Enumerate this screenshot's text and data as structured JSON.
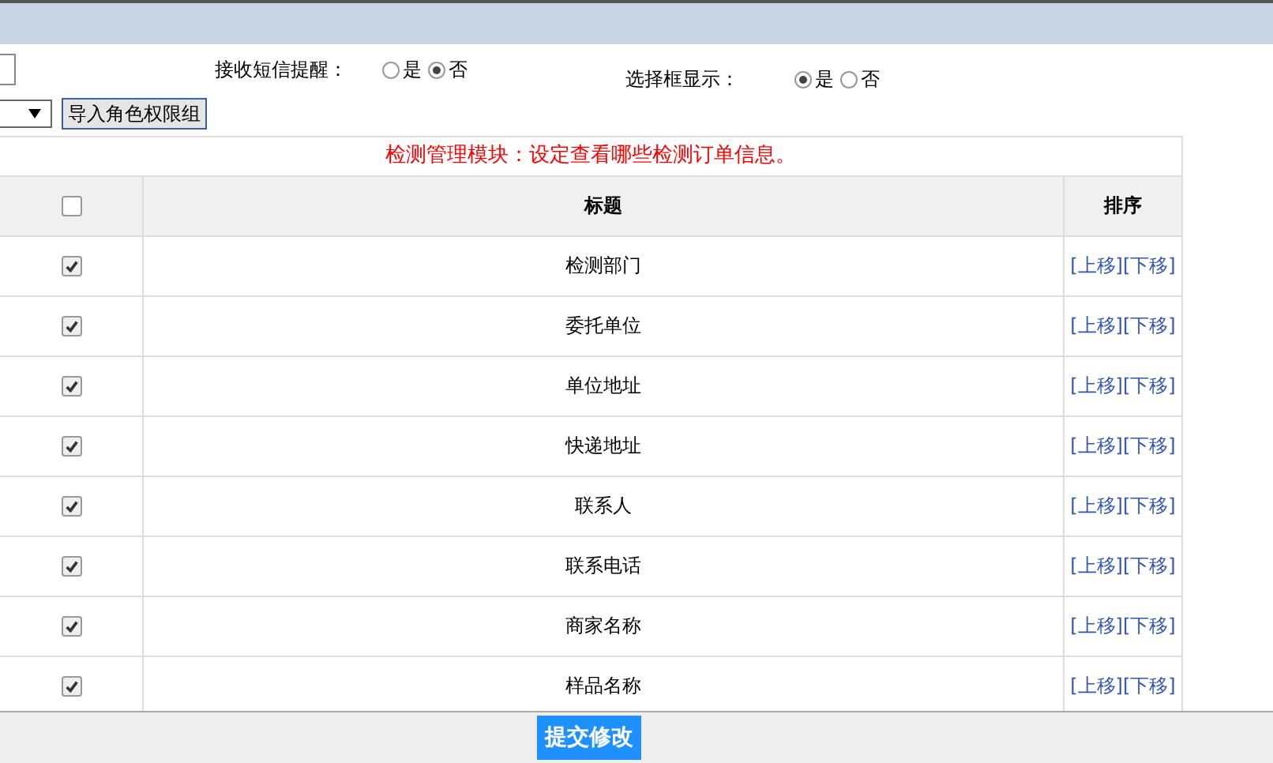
{
  "settings": [
    {
      "label": "接收短信提醒：",
      "options": [
        {
          "label": "是",
          "selected": false
        },
        {
          "label": "否",
          "selected": true
        }
      ]
    },
    {
      "label": "选择框显示：",
      "options": [
        {
          "label": "是",
          "selected": true
        },
        {
          "label": "否",
          "selected": false
        }
      ]
    }
  ],
  "import_button": "导入角色权限组",
  "table": {
    "caption": "检测管理模块：设定查看哪些检测订单信息。",
    "select_all": {
      "checked": false
    },
    "columns": [
      "标题",
      "排序"
    ],
    "rows": [
      {
        "checked": true,
        "title": "检测部门",
        "up": "[上移]",
        "down": "[下移]"
      },
      {
        "checked": true,
        "title": "委托单位",
        "up": "[上移]",
        "down": "[下移]"
      },
      {
        "checked": true,
        "title": "单位地址",
        "up": "[上移]",
        "down": "[下移]"
      },
      {
        "checked": true,
        "title": "快递地址",
        "up": "[上移]",
        "down": "[下移]"
      },
      {
        "checked": true,
        "title": "联系人",
        "up": "[上移]",
        "down": "[下移]"
      },
      {
        "checked": true,
        "title": "联系电话",
        "up": "[上移]",
        "down": "[下移]"
      },
      {
        "checked": true,
        "title": "商家名称",
        "up": "[上移]",
        "down": "[下移]"
      },
      {
        "checked": true,
        "title": "样品名称",
        "up": "[上移]",
        "down": "[下移]"
      }
    ]
  },
  "submit_button": "提交修改"
}
